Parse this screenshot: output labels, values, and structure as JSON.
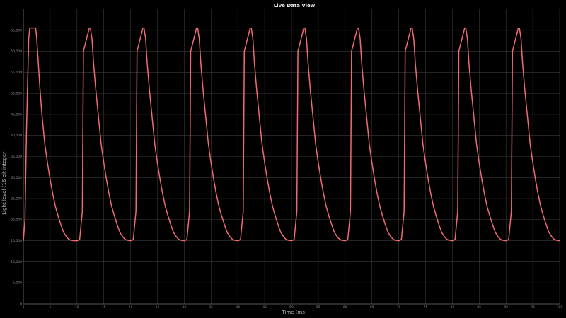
{
  "window": {
    "title": "Live Data View"
  },
  "chart_data": {
    "type": "line",
    "title": "Live Data View",
    "xlabel": "Time (ms)",
    "ylabel": "Light level (16 bit integer)",
    "xlim": [
      0,
      100
    ],
    "ylim": [
      0,
      70000
    ],
    "grid": true,
    "x_ticks": [
      0,
      5,
      10,
      15,
      20,
      25,
      30,
      35,
      40,
      45,
      50,
      55,
      60,
      65,
      70,
      75,
      80,
      85,
      90,
      95,
      100
    ],
    "y_ticks": [
      0,
      5000,
      10000,
      15000,
      20000,
      25000,
      30000,
      35000,
      40000,
      45000,
      50000,
      55000,
      60000,
      65000
    ],
    "y_tick_labels": [
      "0",
      "5,000",
      "10,000",
      "15,000",
      "20,000",
      "25,000",
      "30,000",
      "35,000",
      "40,000",
      "45,000",
      "50,000",
      "55,000",
      "60,000",
      "65,000"
    ],
    "series": [
      {
        "color": "#f06a72",
        "x": [
          0,
          0.3,
          0.6,
          1.0,
          1.2,
          2.3,
          2.5,
          2.8,
          3.1,
          3.5,
          4.0,
          4.5,
          5.0,
          5.5,
          6.0,
          6.5,
          7.0,
          7.5,
          8.0,
          8.5,
          9.0,
          9.5,
          10.0,
          10.5,
          11.0,
          11.2,
          12.3,
          12.5,
          12.8,
          13.1,
          13.5,
          14.0,
          14.5,
          15.0,
          15.5,
          16.0,
          16.5,
          17.0,
          17.5,
          18.0,
          18.5,
          19.0,
          19.5,
          20.0,
          20.5,
          21.0,
          21.2,
          22.3,
          22.5,
          22.8,
          23.1,
          23.5,
          24.0,
          24.5,
          25.0,
          25.5,
          26.0,
          26.5,
          27.0,
          27.5,
          28.0,
          28.5,
          29.0,
          29.5,
          30.0,
          30.5,
          31.0,
          31.2,
          32.3,
          32.5,
          32.8,
          33.1,
          33.5,
          34.0,
          34.5,
          35.0,
          35.5,
          36.0,
          36.5,
          37.0,
          37.5,
          38.0,
          38.5,
          39.0,
          39.5,
          40.0,
          40.5,
          41.0,
          41.2,
          42.3,
          42.5,
          42.8,
          43.1,
          43.5,
          44.0,
          44.5,
          45.0,
          45.5,
          46.0,
          46.5,
          47.0,
          47.5,
          48.0,
          48.5,
          49.0,
          49.5,
          50.0,
          50.5,
          51.0,
          51.2,
          52.3,
          52.5,
          52.8,
          53.1,
          53.5,
          54.0,
          54.5,
          55.0,
          55.5,
          56.0,
          56.5,
          57.0,
          57.5,
          58.0,
          58.5,
          59.0,
          59.5,
          60.0,
          60.5,
          61.0,
          61.2,
          62.3,
          62.5,
          62.8,
          63.1,
          63.5,
          64.0,
          64.5,
          65.0,
          65.5,
          66.0,
          66.5,
          67.0,
          67.5,
          68.0,
          68.5,
          69.0,
          69.5,
          70.0,
          70.5,
          71.0,
          71.2,
          72.3,
          72.5,
          72.8,
          73.1,
          73.5,
          74.0,
          74.5,
          75.0,
          75.5,
          76.0,
          76.5,
          77.0,
          77.5,
          78.0,
          78.5,
          79.0,
          79.5,
          80.0,
          80.5,
          81.0,
          81.2,
          82.3,
          82.5,
          82.8,
          83.1,
          83.5,
          84.0,
          84.5,
          85.0,
          85.5,
          86.0,
          86.5,
          87.0,
          87.5,
          88.0,
          88.5,
          89.0,
          89.5,
          90.0,
          90.5,
          91.0,
          91.2,
          92.3,
          92.5,
          92.8,
          93.1,
          93.5,
          94.0,
          94.5,
          95.0,
          95.5,
          96.0,
          96.5,
          97.0,
          97.5,
          98.0,
          98.5,
          99.0,
          99.5,
          100.0
        ],
        "y": [
          15000,
          20000,
          42000,
          63000,
          65535,
          65535,
          63000,
          57000,
          51000,
          44500,
          38000,
          33500,
          29500,
          26000,
          23000,
          20800,
          18800,
          17000,
          16000,
          15300,
          15100,
          15000,
          15000,
          15300,
          22000,
          60000,
          65535,
          65535,
          63000,
          57000,
          51000,
          44500,
          38000,
          33500,
          29500,
          26000,
          23000,
          20800,
          18800,
          17000,
          16000,
          15300,
          15100,
          15000,
          15300,
          22000,
          60000,
          65535,
          65535,
          63000,
          57000,
          51000,
          44500,
          38000,
          33500,
          29500,
          26000,
          23000,
          20800,
          18800,
          17000,
          16000,
          15300,
          15100,
          15000,
          15300,
          22000,
          60000,
          65535,
          65535,
          63000,
          57000,
          51000,
          44500,
          38000,
          33500,
          29500,
          26000,
          23000,
          20800,
          18800,
          17000,
          16000,
          15300,
          15100,
          15000,
          15300,
          22000,
          60000,
          65535,
          65535,
          63000,
          57000,
          51000,
          44500,
          38000,
          33500,
          29500,
          26000,
          23000,
          20800,
          18800,
          17000,
          16000,
          15300,
          15100,
          15000,
          15300,
          22000,
          60000,
          65535,
          65535,
          63000,
          57000,
          51000,
          44500,
          38000,
          33500,
          29500,
          26000,
          23000,
          20800,
          18800,
          17000,
          16000,
          15300,
          15100,
          15000,
          15300,
          22000,
          60000,
          65535,
          65535,
          63000,
          57000,
          51000,
          44500,
          38000,
          33500,
          29500,
          26000,
          23000,
          20800,
          18800,
          17000,
          16000,
          15300,
          15100,
          15000,
          15300,
          22000,
          60000,
          65535,
          65535,
          63000,
          57000,
          51000,
          44500,
          38000,
          33500,
          29500,
          26000,
          23000,
          20800,
          18800,
          17000,
          16000,
          15300,
          15100,
          15000,
          15300,
          22000,
          60000,
          65535,
          65535,
          63000,
          57000,
          51000,
          44500,
          38000,
          33500,
          29500,
          26000,
          23000,
          20800,
          18800,
          17000,
          16000,
          15300,
          15100,
          15000,
          15300,
          22000,
          60000,
          65535,
          65535,
          63000,
          57000,
          51000,
          44500,
          38000,
          33500,
          29500,
          26000,
          23000,
          20800,
          18800,
          17000,
          16000,
          15300,
          15100,
          15000
        ]
      }
    ]
  }
}
